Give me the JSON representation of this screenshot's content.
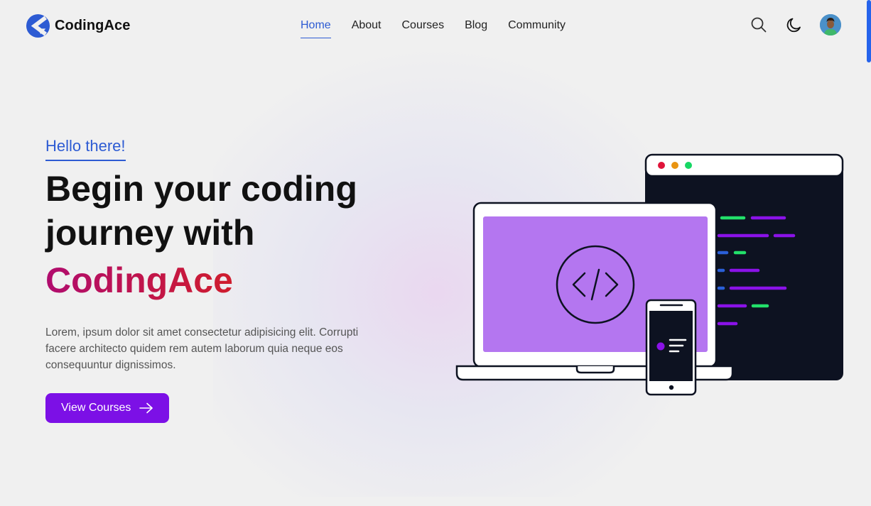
{
  "brand": {
    "name": "CodingAce",
    "logo_icon": "codingace-logo-icon",
    "color": "#2d5bd3"
  },
  "nav": {
    "items": [
      {
        "label": "Home",
        "active": true
      },
      {
        "label": "About",
        "active": false
      },
      {
        "label": "Courses",
        "active": false
      },
      {
        "label": "Blog",
        "active": false
      },
      {
        "label": "Community",
        "active": false
      }
    ]
  },
  "header_tools": {
    "search_icon": "search-icon",
    "theme_icon": "moon-icon",
    "avatar_icon": "user-avatar"
  },
  "hero": {
    "greeting": "Hello there!",
    "title_line1": "Begin your coding",
    "title_line2": "journey with",
    "title_brand": "CodingAce",
    "description": "Lorem, ipsum dolor sit amet consectetur adipisicing elit. Corrupti facere architecto quidem rem autem laborum quia neque eos consequuntur dignissimos.",
    "cta_label": "View Courses",
    "cta_icon": "arrow-right-icon"
  },
  "colors": {
    "accent": "#2d5bd3",
    "cta": "#7c10e6",
    "brand_gradient_start": "#b00c6e",
    "brand_gradient_end": "#cf1d2d",
    "laptop_screen": "#b476f0",
    "code_bg": "#0d1221"
  }
}
